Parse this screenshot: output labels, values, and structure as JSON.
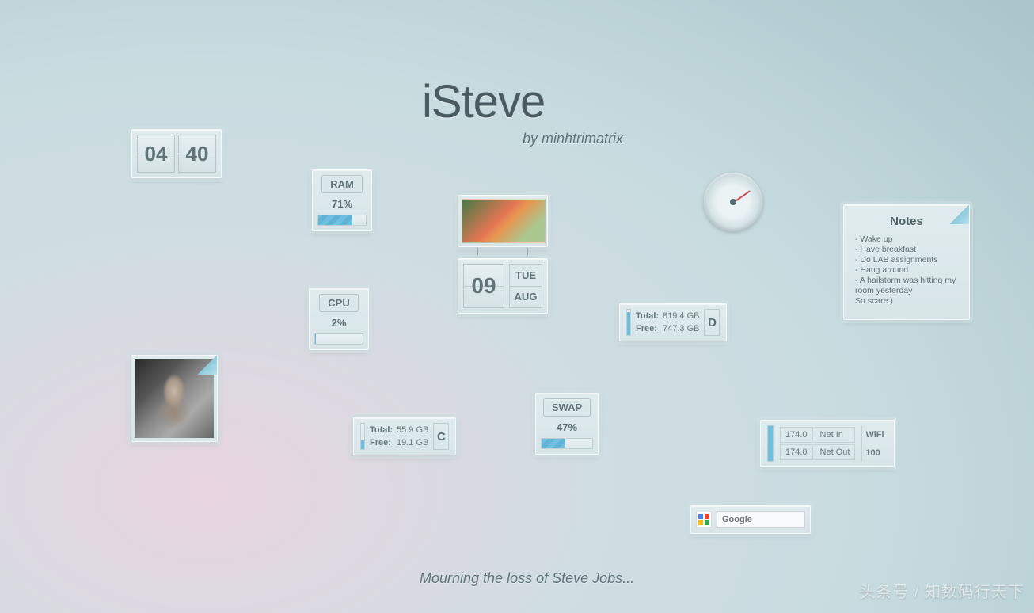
{
  "header": {
    "title": "iSteve",
    "byline": "by minhtrimatrix",
    "footer": "Mourning the loss of Steve Jobs...",
    "watermark": "头条号 / 知数码行天下"
  },
  "clock": {
    "hours": "04",
    "minutes": "40"
  },
  "ram": {
    "label": "RAM",
    "percent": "71%",
    "fill": 71
  },
  "cpu": {
    "label": "CPU",
    "percent": "2%",
    "fill": 2
  },
  "swap": {
    "label": "SWAP",
    "percent": "47%",
    "fill": 47
  },
  "date": {
    "day": "09",
    "weekday": "TUE",
    "month": "AUG"
  },
  "drives": {
    "d": {
      "total_label": "Total:",
      "total": "819.4 GB",
      "free_label": "Free:",
      "free": "747.3 GB",
      "letter": "D",
      "fill": 90
    },
    "c": {
      "total_label": "Total:",
      "total": "55.9 GB",
      "free_label": "Free:",
      "free": "19.1 GB",
      "letter": "C",
      "fill": 34
    }
  },
  "wifi": {
    "name": "WiFi",
    "signal": "100",
    "in_value": "174.0",
    "in_label": "Net In",
    "out_value": "174.0",
    "out_label": "Net Out",
    "fill": 100
  },
  "notes": {
    "title": "Notes",
    "lines": [
      "- Wake up",
      "- Have breakfast",
      "- Do LAB assignments",
      "- Hang around",
      "- A hailstorm was hitting my room yesterday",
      "So scare:)"
    ]
  },
  "search": {
    "placeholder": "Google"
  }
}
